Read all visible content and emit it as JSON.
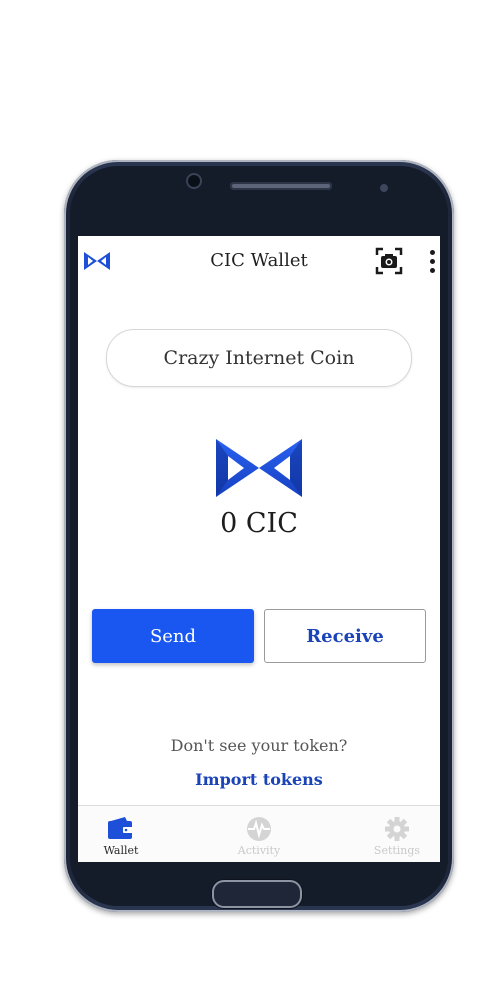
{
  "app": {
    "title": "CIC Wallet",
    "logo_icon": "cic-bowtie-logo-icon",
    "scan_icon": "qr-scan-camera-icon",
    "menu_icon": "more-vertical-icon"
  },
  "token_selector": {
    "label": "Crazy Internet Coin"
  },
  "balance": {
    "text": "0 CIC",
    "token_icon": "cic-bowtie-logo-icon"
  },
  "actions": {
    "send_label": "Send",
    "receive_label": "Receive"
  },
  "import": {
    "hint": "Don't see your token?",
    "link_label": "Import tokens"
  },
  "bottom_nav": {
    "items": [
      {
        "label": "Wallet",
        "icon": "wallet-icon",
        "active": true
      },
      {
        "label": "Activity",
        "icon": "activity-icon",
        "active": false
      },
      {
        "label": "Settings",
        "icon": "gear-icon",
        "active": false
      }
    ]
  },
  "colors": {
    "primary": "#1a57f0",
    "link": "#1a43b8",
    "logo_blue": "#1d4fd8",
    "inactive": "#c9c9c9"
  }
}
